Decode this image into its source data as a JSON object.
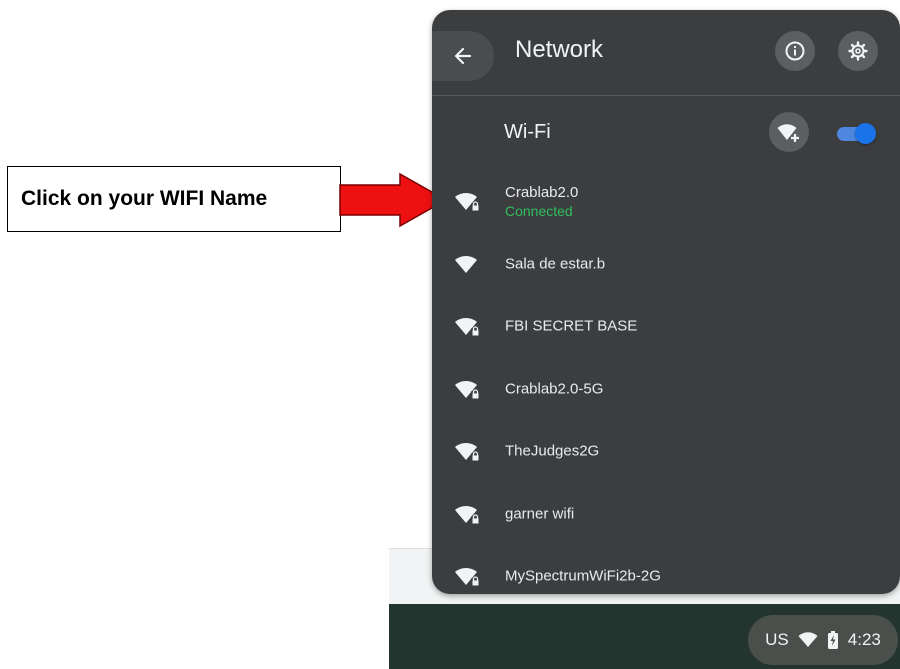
{
  "annotation": {
    "callout_text": "Click on your WIFI Name",
    "arrow_color": "#ee1111"
  },
  "panel": {
    "title": "Network",
    "back_icon": "arrow-left-icon",
    "info_icon": "info-icon",
    "settings_icon": "gear-icon"
  },
  "wifi": {
    "label": "Wi-Fi",
    "add_icon": "add-wifi-icon",
    "enabled": true
  },
  "networks": [
    {
      "name": "Crablab2.0",
      "status": "Connected",
      "secured": true
    },
    {
      "name": "Sala de estar.b",
      "status": "",
      "secured": false
    },
    {
      "name": "FBI SECRET BASE",
      "status": "",
      "secured": true
    },
    {
      "name": "Crablab2.0-5G",
      "status": "",
      "secured": true
    },
    {
      "name": "TheJudges2G",
      "status": "",
      "secured": true
    },
    {
      "name": "garner wifi",
      "status": "",
      "secured": true
    },
    {
      "name": "MySpectrumWiFi2b-2G",
      "status": "",
      "secured": true
    }
  ],
  "shelf": {
    "input_method": "US",
    "time": "4:23",
    "wifi_icon": "wifi-icon",
    "battery_icon": "battery-icon"
  },
  "colors": {
    "panel_bg": "#3c3d3f",
    "connected_green": "#2fbf5e",
    "toggle_blue": "#1a73e8",
    "shelf_bg": "#23352e"
  }
}
